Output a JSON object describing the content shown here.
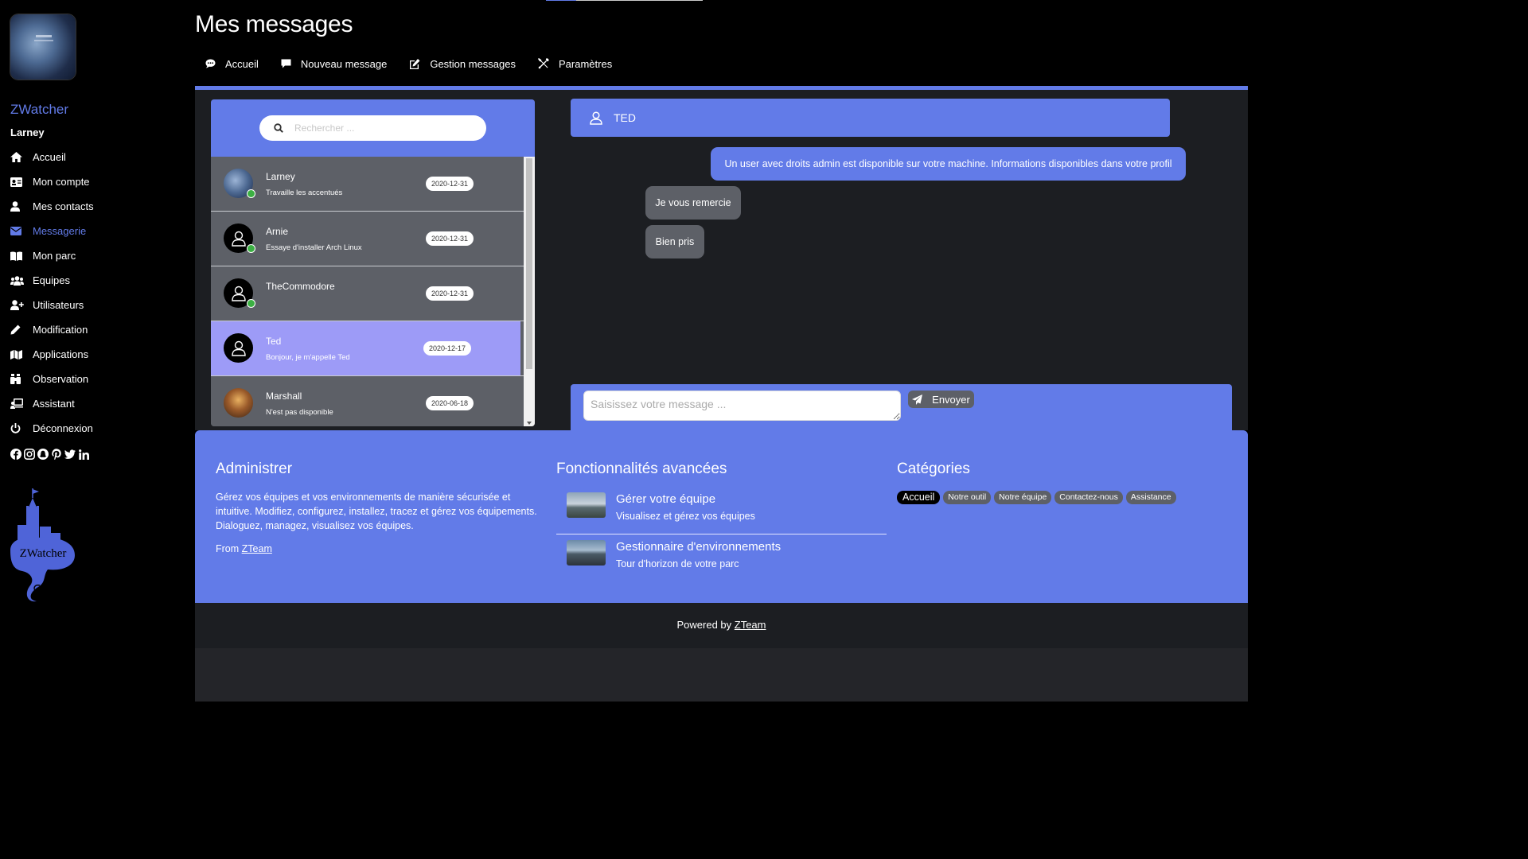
{
  "app": {
    "name": "ZWatcher",
    "user": "Larney"
  },
  "sidebar": {
    "items": [
      {
        "label": "Accueil",
        "icon": "home-icon",
        "active": false
      },
      {
        "label": "Mon compte",
        "icon": "id-card-icon",
        "active": false
      },
      {
        "label": "Mes contacts",
        "icon": "user-icon",
        "active": false
      },
      {
        "label": "Messagerie",
        "icon": "envelope-icon",
        "active": true
      },
      {
        "label": "Mon parc",
        "icon": "book-icon",
        "active": false
      },
      {
        "label": "Equipes",
        "icon": "users-icon",
        "active": false
      },
      {
        "label": "Utilisateurs",
        "icon": "user-plus-icon",
        "active": false
      },
      {
        "label": "Modification",
        "icon": "pencil-icon",
        "active": false
      },
      {
        "label": "Applications",
        "icon": "map-icon",
        "active": false
      },
      {
        "label": "Observation",
        "icon": "binoculars-icon",
        "active": false
      },
      {
        "label": "Assistant",
        "icon": "desk-icon",
        "active": false
      },
      {
        "label": "Déconnexion",
        "icon": "power-icon",
        "active": false
      }
    ],
    "socials": [
      "facebook-icon",
      "instagram-icon",
      "snapchat-icon",
      "pinterest-icon",
      "twitter-icon",
      "linkedin-icon"
    ],
    "logo_text": "ZWatcher"
  },
  "header": {
    "title": "Mes messages",
    "tabs": [
      {
        "label": "Accueil",
        "icon": "comment-dots-icon"
      },
      {
        "label": "Nouveau message",
        "icon": "comment-icon"
      },
      {
        "label": "Gestion messages",
        "icon": "edit-icon"
      },
      {
        "label": "Paramètres",
        "icon": "tools-icon"
      }
    ]
  },
  "search": {
    "placeholder": "Rechercher ..."
  },
  "conversations": [
    {
      "name": "Larney",
      "preview": "Travaille les accentués",
      "date": "2020-12-31",
      "online": true,
      "active": false
    },
    {
      "name": "Arnie",
      "preview": "Essaye d'installer Arch Linux",
      "date": "2020-12-31",
      "online": true,
      "active": false
    },
    {
      "name": "TheCommodore",
      "preview": "",
      "date": "2020-12-31",
      "online": true,
      "active": false
    },
    {
      "name": "Ted",
      "preview": "Bonjour, je m'appelle Ted",
      "date": "2020-12-17",
      "online": false,
      "active": true
    },
    {
      "name": "Marshall",
      "preview": "N'est pas disponible",
      "date": "2020-06-18",
      "online": false,
      "active": false
    }
  ],
  "chat": {
    "contact": "TED",
    "messages": [
      {
        "from": "out",
        "text": "Un user avec droits admin est disponible sur votre machine. Informations disponibles dans votre profil"
      },
      {
        "from": "in",
        "text": "Je vous remercie"
      },
      {
        "from": "in",
        "text": "Bien pris"
      }
    ],
    "input_placeholder": "Saisissez votre message ...",
    "send_label": "Envoyer"
  },
  "footer": {
    "admin": {
      "title": "Administrer",
      "text": "Gérez vos équipes et vos environnements de manière sécurisée et intuitive. Modifiez, configurez, installez, tracez et gérez vos équipements. Dialoguez, managez, visualisez vos équipes.",
      "from_label": "From",
      "from_link": "ZTeam"
    },
    "features": {
      "title": "Fonctionnalités avancées",
      "items": [
        {
          "title": "Gérer votre équipe",
          "subtitle": "Visualisez et gérez vos équipes"
        },
        {
          "title": "Gestionnaire d'environnements",
          "subtitle": "Tour d'horizon de votre parc"
        }
      ]
    },
    "categories": {
      "title": "Catégories",
      "tags": [
        "Accueil",
        "Notre outil",
        "Notre équipe",
        "Contactez-nous",
        "Assistance"
      ]
    },
    "powered_label": "Powered by",
    "powered_link": "ZTeam"
  },
  "colors": {
    "accent": "#627be8",
    "panel": "#5d6067",
    "active_conversation": "#9d9bf7",
    "online": "#3cb043"
  }
}
